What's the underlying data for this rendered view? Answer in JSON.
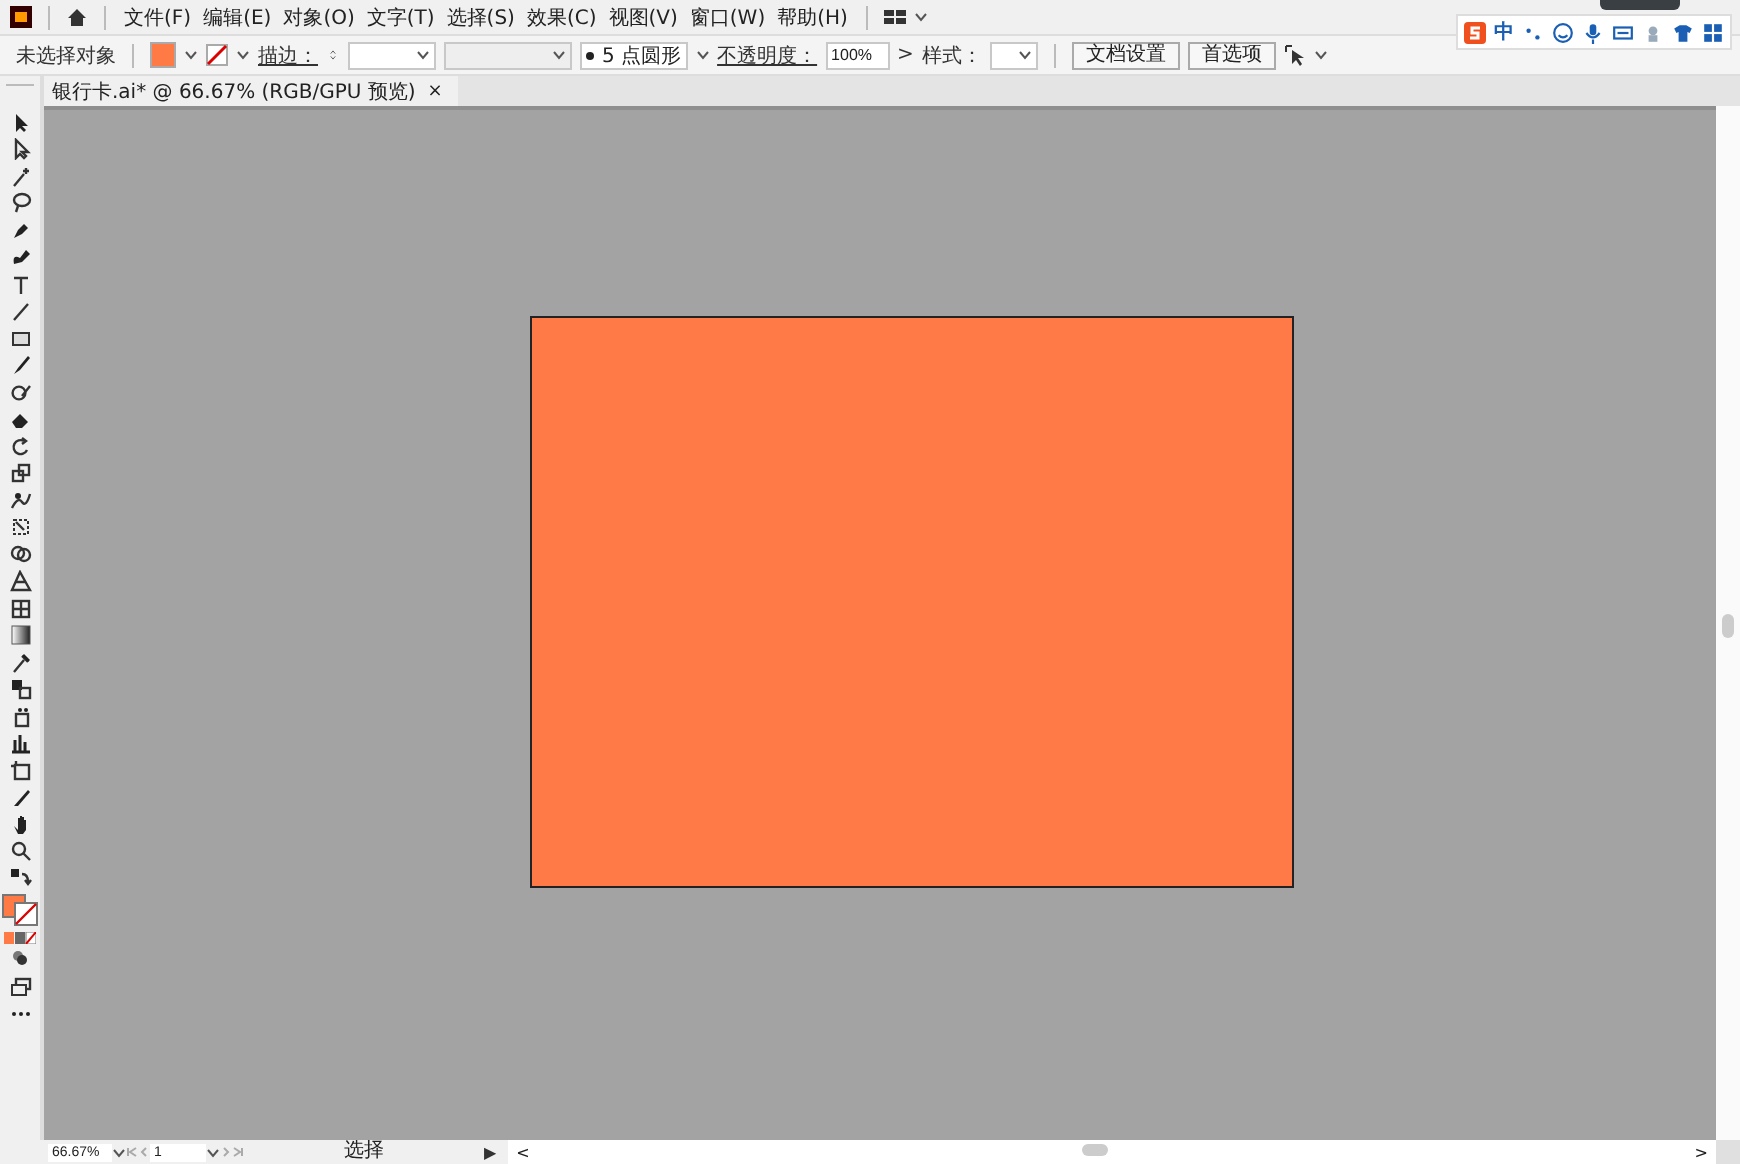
{
  "menu_bar": {
    "menus": [
      "文件(F)",
      "编辑(E)",
      "对象(O)",
      "文字(T)",
      "选择(S)",
      "效果(C)",
      "视图(V)",
      "窗口(W)",
      "帮助(H)"
    ]
  },
  "control_bar": {
    "selection_label": "未选择对象",
    "stroke_label": "描边：",
    "brush": "5 点圆形",
    "opacity_label": "不透明度：",
    "opacity_value": "100%",
    "opacity_arrow": ">",
    "style_label": "样式：",
    "buttons": [
      "文档设置",
      "首选项"
    ]
  },
  "ime_bar": {
    "label": "中"
  },
  "document_tab": {
    "title": "银行卡.ai* @ 66.67% (RGB/GPU 预览)",
    "close": "×"
  },
  "status_bar": {
    "zoom": "66.67%",
    "page": "1",
    "tool": "选择",
    "play": "▶",
    "scroll_left": "<",
    "scroll_right": ">"
  }
}
